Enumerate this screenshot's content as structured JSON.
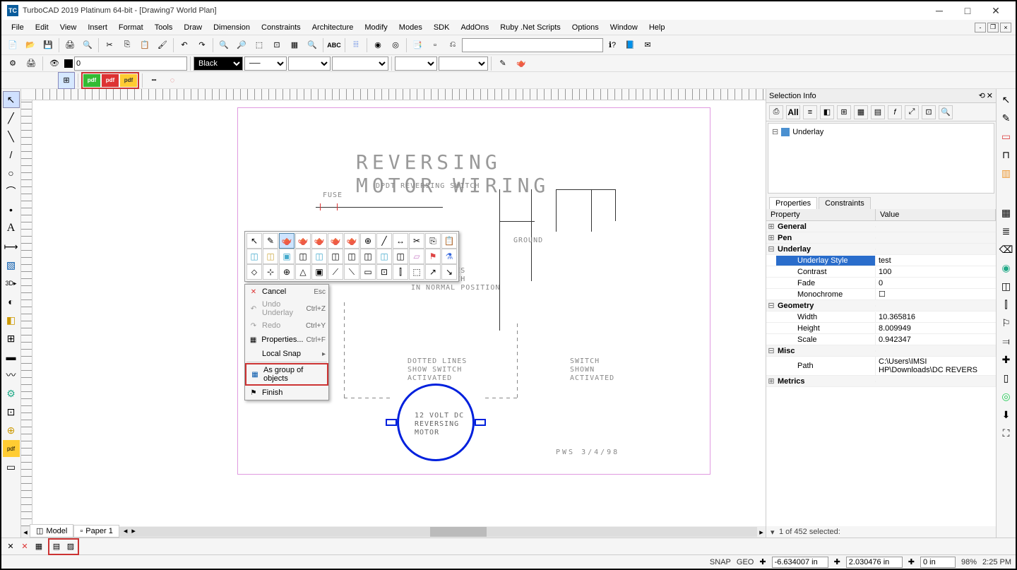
{
  "title": "TurboCAD 2019 Platinum 64-bit - [Drawing7 World Plan]",
  "menus": [
    "File",
    "Edit",
    "View",
    "Insert",
    "Format",
    "Tools",
    "Draw",
    "Dimension",
    "Constraints",
    "Architecture",
    "Modify",
    "Modes",
    "SDK",
    "AddOns",
    "Ruby .Net Scripts",
    "Options",
    "Window",
    "Help"
  ],
  "toolbar2": {
    "layer_value": "0",
    "color_value": "Black"
  },
  "drawing": {
    "title": "REVERSING MOTOR WIRING",
    "fuse": "FUSE",
    "switch_label": "DPDT REVERSING SWITCH",
    "ground": "GROUND",
    "solid": "SOLID LINES\nSHOW SWITCH\nIN NORMAL POSITION",
    "dotted": "DOTTED LINES\nSHOW SWITCH\nACTIVATED",
    "switch_shown": "SWITCH\nSHOWN\nACTIVATED",
    "motor": "12 VOLT DC\nREVERSING\nMOTOR",
    "sig": "PWS  3/4/98"
  },
  "context_menu": [
    {
      "icon": "✕",
      "label": "Cancel",
      "shortcut": "Esc",
      "enabled": true,
      "red": true
    },
    {
      "icon": "↶",
      "label": "Undo Underlay",
      "shortcut": "Ctrl+Z",
      "enabled": false
    },
    {
      "icon": "↷",
      "label": "Redo",
      "shortcut": "Ctrl+Y",
      "enabled": false
    },
    {
      "icon": "▦",
      "label": "Properties...",
      "shortcut": "Ctrl+F",
      "enabled": true
    },
    {
      "icon": "",
      "label": "Local Snap",
      "shortcut": "▸",
      "enabled": true
    },
    {
      "icon": "▦",
      "label": "As group of objects",
      "shortcut": "",
      "enabled": true,
      "highlight": true
    },
    {
      "icon": "⚑",
      "label": "Finish",
      "shortcut": "",
      "enabled": true
    }
  ],
  "selection_info": {
    "panel_title": "Selection Info",
    "tree_item": "Underlay",
    "all": "All"
  },
  "properties": {
    "tab1": "Properties",
    "tab2": "Constraints",
    "col1": "Property",
    "col2": "Value",
    "groups": [
      {
        "name": "General",
        "expanded": false,
        "items": []
      },
      {
        "name": "Pen",
        "expanded": false,
        "items": []
      },
      {
        "name": "Underlay",
        "expanded": true,
        "items": [
          {
            "key": "Underlay Style",
            "val": "test",
            "selected": true
          },
          {
            "key": "Contrast",
            "val": "100"
          },
          {
            "key": "Fade",
            "val": "0"
          },
          {
            "key": "Monochrome",
            "val": "☐"
          }
        ]
      },
      {
        "name": "Geometry",
        "expanded": true,
        "items": [
          {
            "key": "Width",
            "val": "10.365816"
          },
          {
            "key": "Height",
            "val": "8.009949"
          },
          {
            "key": "Scale",
            "val": "0.942347"
          }
        ]
      },
      {
        "name": "Misc",
        "expanded": true,
        "items": [
          {
            "key": "Path",
            "val": "C:\\Users\\IMSI HP\\Downloads\\DC REVERS"
          }
        ]
      },
      {
        "name": "Metrics",
        "expanded": false,
        "items": []
      }
    ]
  },
  "selection_status": "1 of 452 selected:",
  "tabs": {
    "model": "Model",
    "paper": "Paper 1"
  },
  "status": {
    "snap": "SNAP",
    "geo": "GEO",
    "x": "-6.634007 in",
    "y": "2.030476 in",
    "z": "0 in",
    "zoom": "98%",
    "time": "2:25 PM"
  }
}
